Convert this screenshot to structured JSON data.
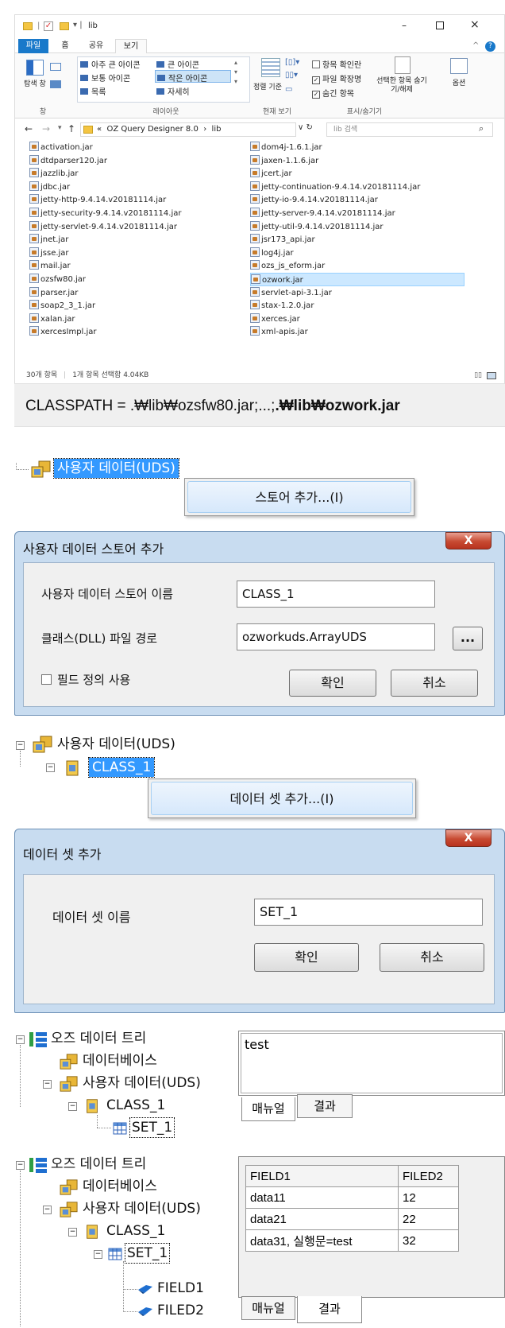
{
  "explorer": {
    "title": "lib",
    "tabs": [
      "파일",
      "홈",
      "공유",
      "보기"
    ],
    "layout_options": [
      "아주 큰 아이콘",
      "큰 아이콘",
      "보통 아이콘",
      "작은 아이콘",
      "목록",
      "자세히"
    ],
    "panes": {
      "pane_label": "탐색 창",
      "pane_group": "창",
      "layout_group": "레이아웃"
    },
    "sort": {
      "label": "정렬 기준",
      "group": "현재 보기"
    },
    "show_hide": {
      "item_checkbox": "항목 확인란",
      "extensions": "파일 확장명",
      "hidden": "숨긴 항목",
      "hide_selected": "선택한 항목 숨기기/해제",
      "group": "표시/숨기기"
    },
    "options_label": "옵션",
    "path": [
      "«",
      "OZ Query Designer 8.0",
      "›",
      "lib"
    ],
    "search_placeholder": "lib 검색",
    "files_left": [
      "activation.jar",
      "dtdparser120.jar",
      "jazzlib.jar",
      "jdbc.jar",
      "jetty-http-9.4.14.v20181114.jar",
      "jetty-security-9.4.14.v20181114.jar",
      "jetty-servlet-9.4.14.v20181114.jar",
      "jnet.jar",
      "jsse.jar",
      "mail.jar",
      "ozsfw80.jar",
      "parser.jar",
      "soap2_3_1.jar",
      "xalan.jar",
      "xercesImpl.jar"
    ],
    "files_right": [
      "dom4j-1.6.1.jar",
      "jaxen-1.1.6.jar",
      "jcert.jar",
      "jetty-continuation-9.4.14.v20181114.jar",
      "jetty-io-9.4.14.v20181114.jar",
      "jetty-server-9.4.14.v20181114.jar",
      "jetty-util-9.4.14.v20181114.jar",
      "jsr173_api.jar",
      "log4j.jar",
      "ozs_js_eform.jar",
      "ozwork.jar",
      "servlet-api-3.1.jar",
      "stax-1.2.0.jar",
      "xerces.jar",
      "xml-apis.jar"
    ],
    "selected_file": "ozwork.jar",
    "status": {
      "count": "30개 항목",
      "selected": "1개 항목 선택함 4.04KB"
    }
  },
  "classpath": {
    "prefix": "CLASSPATH = .₩lib₩ozsfw80.jar;...;",
    "bold": ".₩lib₩ozwork.jar"
  },
  "step1": {
    "node": "사용자 데이터(UDS)",
    "menu": "스토어 추가...(I)"
  },
  "dialog1": {
    "title": "사용자 데이터 스토어 추가",
    "close": "X",
    "name_label": "사용자 데이터 스토어 이름",
    "name_value": "CLASS_1",
    "path_label": "클래스(DLL) 파일 경로",
    "path_value": "ozworkuds.ArrayUDS",
    "browse": "...",
    "checkbox": "필드 정의 사용",
    "ok": "확인",
    "cancel": "취소"
  },
  "step2": {
    "root": "사용자 데이터(UDS)",
    "child": "CLASS_1",
    "menu": "데이터 셋 추가...(I)"
  },
  "dialog2": {
    "title": "데이터 셋 추가",
    "close": "X",
    "name_label": "데이터 셋 이름",
    "name_value": "SET_1",
    "ok": "확인",
    "cancel": "취소"
  },
  "tree1": {
    "root": "오즈 데이터 트리",
    "db": "데이터베이스",
    "uds": "사용자 데이터(UDS)",
    "cls": "CLASS_1",
    "set": "SET_1"
  },
  "panel1": {
    "text": "test",
    "tab_manual": "매뉴얼",
    "tab_result": "결과"
  },
  "tree2": {
    "root": "오즈 데이터 트리",
    "db": "데이터베이스",
    "uds": "사용자 데이터(UDS)",
    "cls": "CLASS_1",
    "set": "SET_1",
    "field1": "FIELD1",
    "field2": "FILED2"
  },
  "panel2": {
    "headers": [
      "FIELD1",
      "FILED2"
    ],
    "rows": [
      [
        "data11",
        "12"
      ],
      [
        "data21",
        "22"
      ],
      [
        "data31, 실행문=test",
        "32"
      ]
    ],
    "tab_manual": "매뉴얼",
    "tab_result": "결과"
  }
}
